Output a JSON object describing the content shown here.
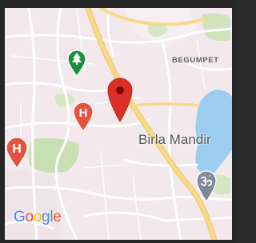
{
  "map": {
    "area_label": "BEGUMPET",
    "place_label": "Birla Mandir",
    "markers": [
      {
        "kind": "park",
        "icon": "tree-icon",
        "color": "#1e8e3e"
      },
      {
        "kind": "selected-location",
        "icon": "pin-icon",
        "color": "#db2f25"
      },
      {
        "kind": "hospital",
        "letter": "H",
        "color": "#e5533f"
      },
      {
        "kind": "hospital",
        "letter": "H",
        "color": "#e5533f"
      },
      {
        "kind": "place-of-worship",
        "icon": "om-icon",
        "color": "#7d8a99"
      }
    ],
    "colors": {
      "land": "#f3e9ec",
      "water": "#9ccdf0",
      "park": "#c9dfb4",
      "road_major": "#f7d98b",
      "road_minor": "#ffffff"
    }
  },
  "logo": {
    "letters": [
      {
        "char": "G",
        "color": "#4285F4"
      },
      {
        "char": "o",
        "color": "#EA4335"
      },
      {
        "char": "o",
        "color": "#FBBC05"
      },
      {
        "char": "g",
        "color": "#4285F4"
      },
      {
        "char": "l",
        "color": "#34A853"
      },
      {
        "char": "e",
        "color": "#EA4335"
      }
    ]
  }
}
